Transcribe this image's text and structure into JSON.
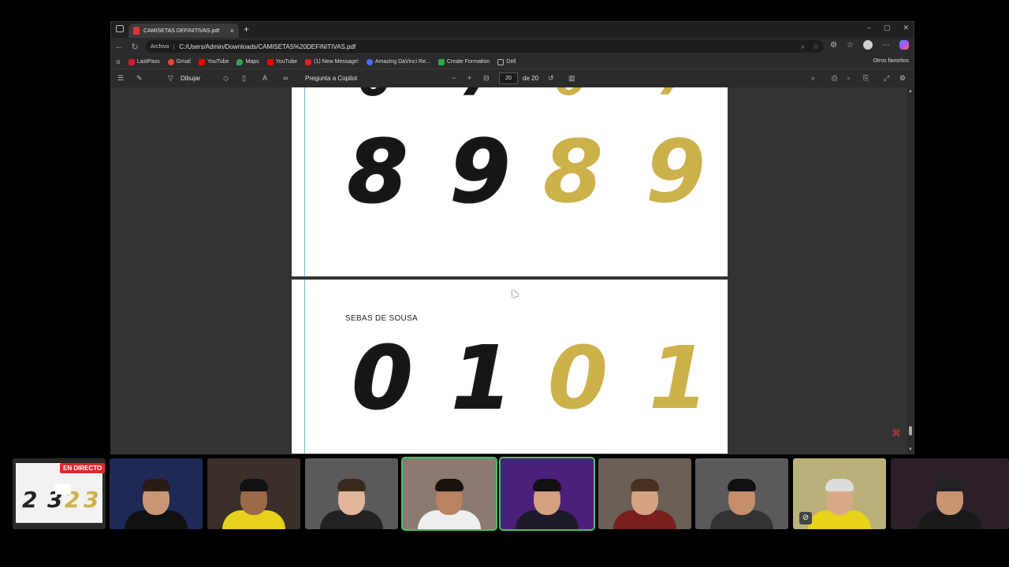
{
  "browser": {
    "tab_title": "CAMISETAS DEFINITIVAS.pdf",
    "tab_close": "×",
    "new_tab": "+",
    "address_prefix": "Archivo",
    "url": "C:/Users/Admin/Downloads/CAMISETAS%20DEFINITIVAS.pdf",
    "window_controls": [
      "–",
      "▢",
      "✕"
    ],
    "bookmarks": [
      {
        "label": "LastPass",
        "color": "#cc2030"
      },
      {
        "label": "Gmail",
        "color": "#ea4335"
      },
      {
        "label": "YouTube",
        "color": "#ff0000"
      },
      {
        "label": "Maps",
        "color": "#34a853"
      },
      {
        "label": "YouTube",
        "color": "#ff0000"
      },
      {
        "label": "(1) New Message!",
        "color": "#e02020"
      },
      {
        "label": "Amazing DaVinci Re...",
        "color": "#4a6cff"
      },
      {
        "label": "Create Formation",
        "color": "#2ea84a"
      },
      {
        "label": "Dell",
        "color": "#888888"
      }
    ],
    "other_favorites": "Otros favoritos"
  },
  "pdf_toolbar": {
    "draw_label": "Dibujar",
    "copilot_label": "Pregunta a Copilot",
    "page_current": "20",
    "page_total": "de 20"
  },
  "pdf": {
    "page1_numbers": [
      {
        "text": "8",
        "style": "black"
      },
      {
        "text": "9",
        "style": "black"
      },
      {
        "text": "8",
        "style": "gold"
      },
      {
        "text": "9",
        "style": "gold"
      }
    ],
    "page2_label": "SEBAS DE SOUSA",
    "page2_numbers": [
      {
        "text": "0",
        "style": "black"
      },
      {
        "text": "1",
        "style": "black"
      },
      {
        "text": "0",
        "style": "gold"
      },
      {
        "text": "1",
        "style": "gold"
      }
    ]
  },
  "stream": {
    "live_badge": "EN DIRECTO",
    "participants": [
      {
        "name": "screen-share",
        "bg": "#2a2a2a"
      },
      {
        "name": "participant-1",
        "bg": "#1e2a55"
      },
      {
        "name": "participant-2",
        "bg": "#3a2f2a"
      },
      {
        "name": "participant-3",
        "bg": "#5a5a5a"
      },
      {
        "name": "participant-4",
        "bg": "#8a7a70"
      },
      {
        "name": "participant-5",
        "bg": "#4b1f7a"
      },
      {
        "name": "participant-6",
        "bg": "#6a6055"
      },
      {
        "name": "participant-7",
        "bg": "#5a5a5a"
      },
      {
        "name": "participant-8",
        "bg": "#b9b07a"
      },
      {
        "name": "participant-9",
        "bg": "#2d1f2a"
      }
    ]
  },
  "colors": {
    "gold": "#cdb14a",
    "accent_active": "#3ec46d",
    "live_red": "#e0282e"
  }
}
